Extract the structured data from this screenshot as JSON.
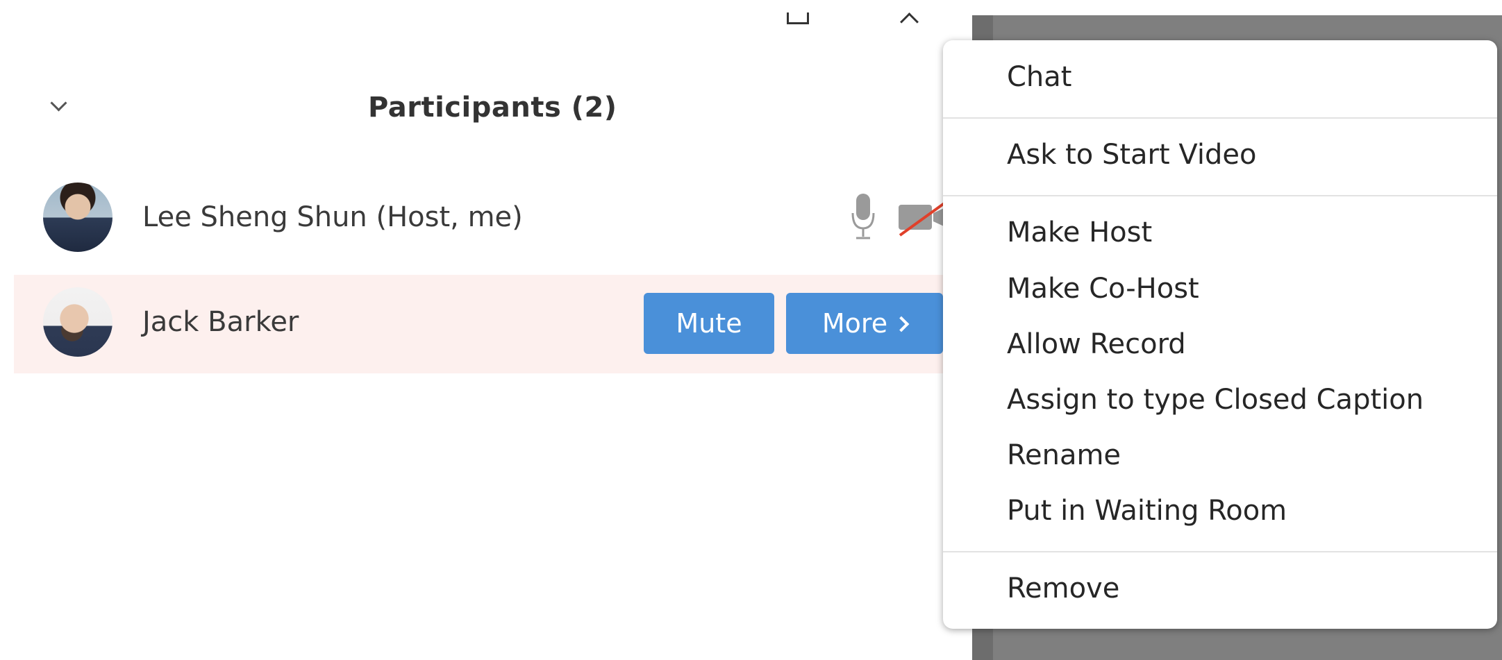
{
  "window": {
    "restore_icon": "restore-window-icon",
    "collapse_icon": "caret-up-icon"
  },
  "panel": {
    "title": "Participants (2)",
    "collapse_icon": "chevron-down-icon"
  },
  "participants": [
    {
      "name": "Lee Sheng Shun (Host, me)",
      "mic_icon": "microphone-icon",
      "video_icon": "video-off-icon"
    },
    {
      "name": "Jack Barker",
      "mute_label": "Mute",
      "more_label": "More"
    }
  ],
  "menu": {
    "items": [
      "Chat",
      "Ask to Start Video",
      "Make Host",
      "Make Co-Host",
      "Allow Record",
      "Assign to type Closed Caption",
      "Rename",
      "Put in Waiting Room",
      "Remove"
    ]
  },
  "colors": {
    "button": "#4a90d9",
    "selected_row": "#fdf0ee",
    "backdrop": "#7f7f7f"
  }
}
